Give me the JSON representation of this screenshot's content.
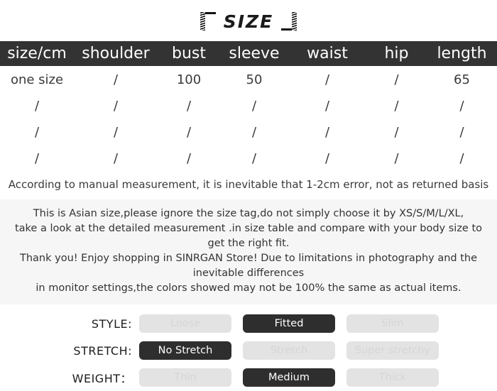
{
  "title": {
    "text": "SIZE",
    "left_bracket_icon": "corner-bracket-left-icon",
    "right_bracket_icon": "corner-bracket-right-icon"
  },
  "table": {
    "headers": [
      "size/cm",
      "shoulder",
      "bust",
      "sleeve",
      "waist",
      "hip",
      "length"
    ],
    "rows": [
      [
        "one size",
        "/",
        "100",
        "50",
        "/",
        "/",
        "65"
      ],
      [
        "/",
        "/",
        "/",
        "/",
        "/",
        "/",
        "/"
      ],
      [
        "/",
        "/",
        "/",
        "/",
        "/",
        "/",
        "/"
      ],
      [
        "/",
        "/",
        "/",
        "/",
        "/",
        "/",
        "/"
      ]
    ]
  },
  "note": "According to manual measurement, it is inevitable that 1-2cm error, not as returned basis",
  "description": {
    "line1": "This is Asian size,please ignore the size tag,do not simply choose it by XS/S/M/L/XL,",
    "line2": "take a look at the detailed measurement .in size table and compare with your body size to get the right fit.",
    "line3": "Thank you! Enjoy shopping in SINRGAN Store!  Due to limitations in photography and the inevitable differences",
    "line4": "in monitor settings,the colors showed may not be 100% the same as actual items."
  },
  "attributes": [
    {
      "label": "STYLE:",
      "options": [
        {
          "text": "Loose",
          "selected": false
        },
        {
          "text": "Fitted",
          "selected": true
        },
        {
          "text": "Slim",
          "selected": false
        }
      ]
    },
    {
      "label": "STRETCH:",
      "options": [
        {
          "text": "No Stretch",
          "selected": true
        },
        {
          "text": "Stretch",
          "selected": false
        },
        {
          "text": "Super stretchy",
          "selected": false
        }
      ]
    },
    {
      "label": "WEIGHT：",
      "options": [
        {
          "text": "Thin",
          "selected": false
        },
        {
          "text": "Medium",
          "selected": true
        },
        {
          "text": "Thick",
          "selected": false
        }
      ]
    }
  ],
  "colors": {
    "header_bar": "#333333",
    "selected_pill": "#2e2e2e",
    "unselected_pill": "#e3e3e3",
    "description_band": "#f6f6f6"
  }
}
